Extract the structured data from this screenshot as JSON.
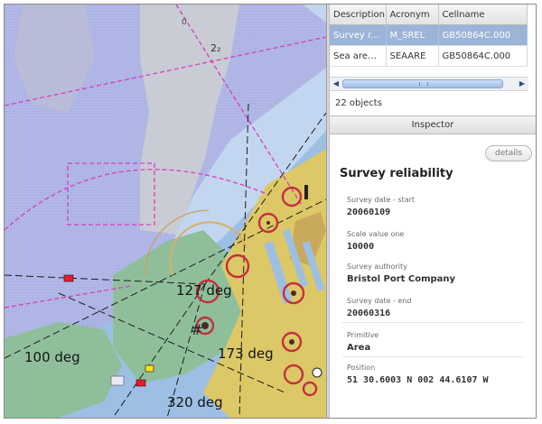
{
  "object_table": {
    "columns": [
      "Description",
      "Acronym",
      "Cellname"
    ],
    "rows": [
      {
        "description": "Survey r...",
        "acronym": "M_SREL",
        "cellname": "GB50864C.000",
        "selected": true
      },
      {
        "description": "Sea area...",
        "acronym": "SEAARE",
        "cellname": "GB50864C.000",
        "selected": false
      }
    ],
    "scroll_left_icon": "chevron-left-icon",
    "scroll_right_icon": "chevron-right-icon"
  },
  "object_count": "22 objects",
  "inspector": {
    "header": "Inspector",
    "details_button": "details",
    "title": "Survey reliability",
    "fields": [
      {
        "label": "Survey date - start",
        "value": "20060109"
      },
      {
        "label": "Scale value one",
        "value": "10000"
      },
      {
        "label": "Survey authority",
        "value": "Bristol Port Company"
      },
      {
        "label": "Survey date - end",
        "value": "20060316"
      },
      {
        "label": "Primitive",
        "value": "Area"
      },
      {
        "label": "Position",
        "value": "51 30.6003 N  002 44.6107 W"
      }
    ]
  },
  "chart_view": {
    "bearing_labels": [
      "127 deg",
      "173 deg",
      "100 deg",
      "320 deg"
    ],
    "colors": {
      "land": "#dcc866",
      "intertidal": "#8fbf9a",
      "shallow_water": "#9dbfe3",
      "deep_water": "#c3d6ef",
      "survey_area": "#aeb2e4",
      "magenta_lines": "#d93ec0",
      "range_rings": "#c4303e"
    }
  }
}
